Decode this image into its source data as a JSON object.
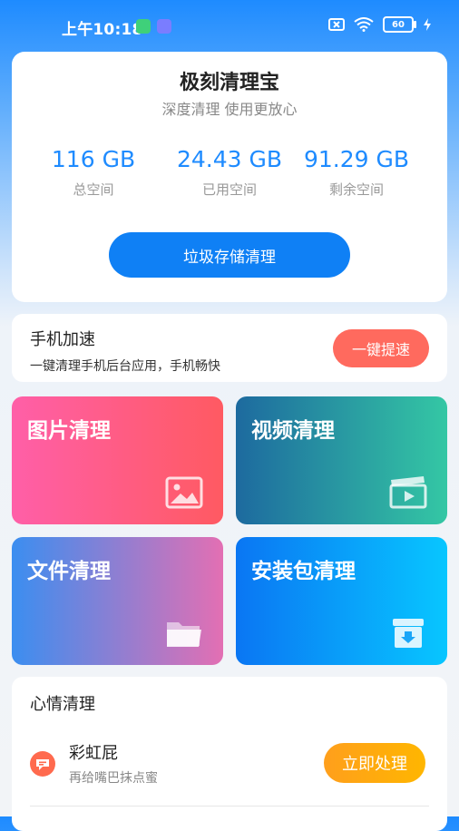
{
  "status_bar": {
    "time": "上午10:18",
    "battery": "60"
  },
  "storage": {
    "title": "极刻清理宝",
    "subtitle": "深度清理 使用更放心",
    "stats": [
      {
        "value": "116 GB",
        "label": "总空间"
      },
      {
        "value": "24.43 GB",
        "label": "已用空间"
      },
      {
        "value": "91.29 GB",
        "label": "剩余空间"
      }
    ],
    "button_label": "垃圾存储清理"
  },
  "boost": {
    "title": "手机加速",
    "description": "一键清理手机后台应用，手机畅快",
    "button_label": "一键提速"
  },
  "tiles": [
    {
      "label": "图片清理",
      "icon": "image-icon"
    },
    {
      "label": "视频清理",
      "icon": "video-icon"
    },
    {
      "label": "文件清理",
      "icon": "folder-icon"
    },
    {
      "label": "安装包清理",
      "icon": "package-icon"
    }
  ],
  "mood": {
    "title": "心情清理",
    "item_name": "彩虹屁",
    "item_desc": "再给嘴巴抹点蜜",
    "button_label": "立即处理"
  }
}
